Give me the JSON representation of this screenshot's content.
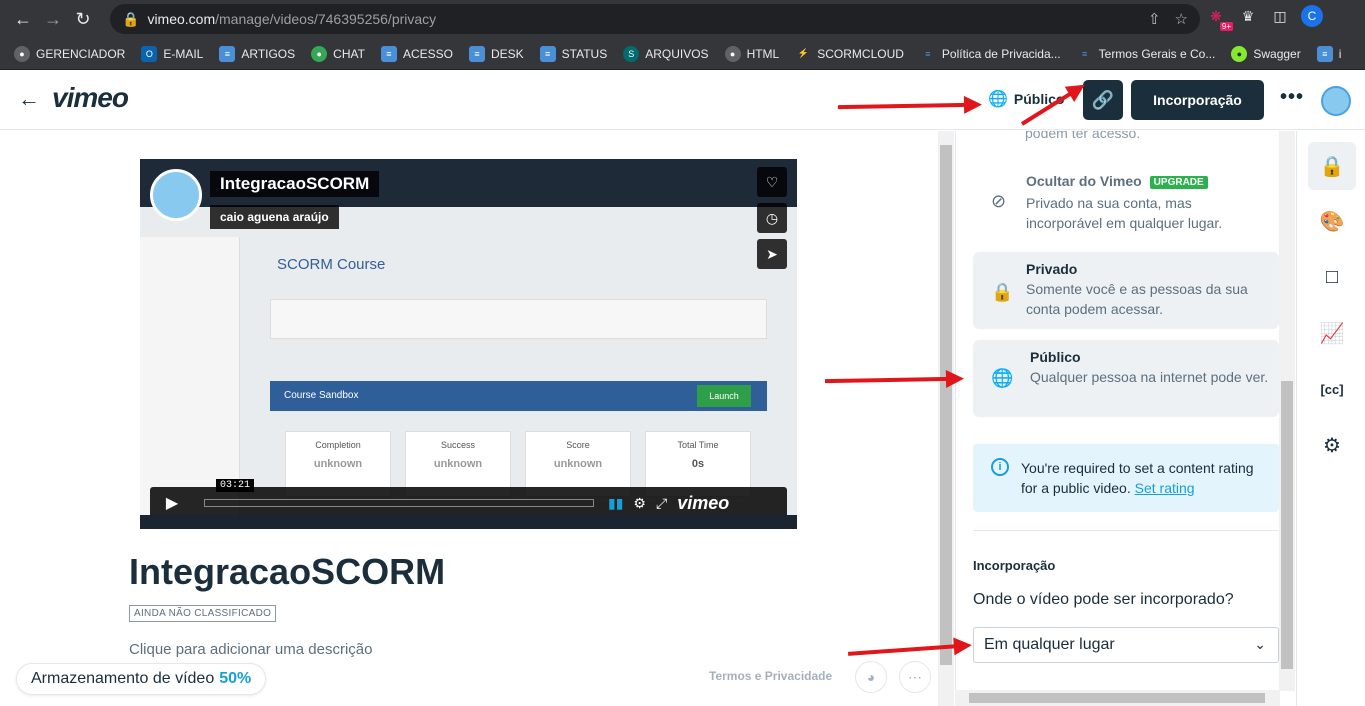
{
  "browser": {
    "url_host": "vimeo.com",
    "url_path": "/manage/videos/746395256/privacy",
    "profile_initial": "C",
    "ext_badge": "9+",
    "bookmarks": [
      "GERENCIADOR",
      "E-MAIL",
      "ARTIGOS",
      "CHAT",
      "ACESSO",
      "DESK",
      "STATUS",
      "ARQUIVOS",
      "HTML",
      "SCORMCLOUD",
      "Política de Privacida...",
      "Termos Gerais e Co...",
      "Swagger",
      "i"
    ]
  },
  "header": {
    "logo": "vimeo",
    "privacy_label": "Público",
    "embed_label": "Incorporação",
    "more": "•••"
  },
  "player": {
    "title": "IntegracaoSCORM",
    "author": "caio aguena araújo",
    "time": "03:21",
    "logo": "vimeo",
    "mock_title": "SCORM Course",
    "mock_sandbox": "Course Sandbox",
    "mock_launch": "Launch",
    "mock_cards": [
      {
        "label": "Completion",
        "value": "unknown"
      },
      {
        "label": "Success",
        "value": "unknown"
      },
      {
        "label": "Score",
        "value": "unknown"
      },
      {
        "label": "Total Time",
        "value": "0s"
      }
    ]
  },
  "video": {
    "title": "IntegracaoSCORM",
    "rating_badge": "AINDA NÃO CLASSIFICADO",
    "description_placeholder": "Clique para adicionar uma descrição"
  },
  "storage": {
    "label": "Armazenamento de vídeo",
    "percent": "50%"
  },
  "footer": {
    "terms": "Termos e Privacidade"
  },
  "panel": {
    "faded_top": "podem ter acesso.",
    "options": {
      "hide": {
        "title": "Ocultar do Vimeo",
        "badge": "UPGRADE",
        "desc": "Privado na sua conta, mas incorporável em qualquer lugar."
      },
      "private": {
        "title": "Privado",
        "desc": "Somente você e as pessoas da sua conta podem acessar."
      },
      "public": {
        "title": "Público",
        "desc": "Qualquer pessoa na internet pode ver."
      }
    },
    "info": {
      "text": "You're required to set a content rating for a public video.",
      "link": "Set rating"
    },
    "embed_section": {
      "label": "Incorporação",
      "question": "Onde o vídeo pode ser incorporado?",
      "selected": "Em qualquer lugar"
    }
  },
  "colors": {
    "brand_dark": "#1a2e3b",
    "accent_blue": "#17a0d8",
    "upgrade_green": "#2bb24c",
    "annotation_red": "#e0161a"
  }
}
